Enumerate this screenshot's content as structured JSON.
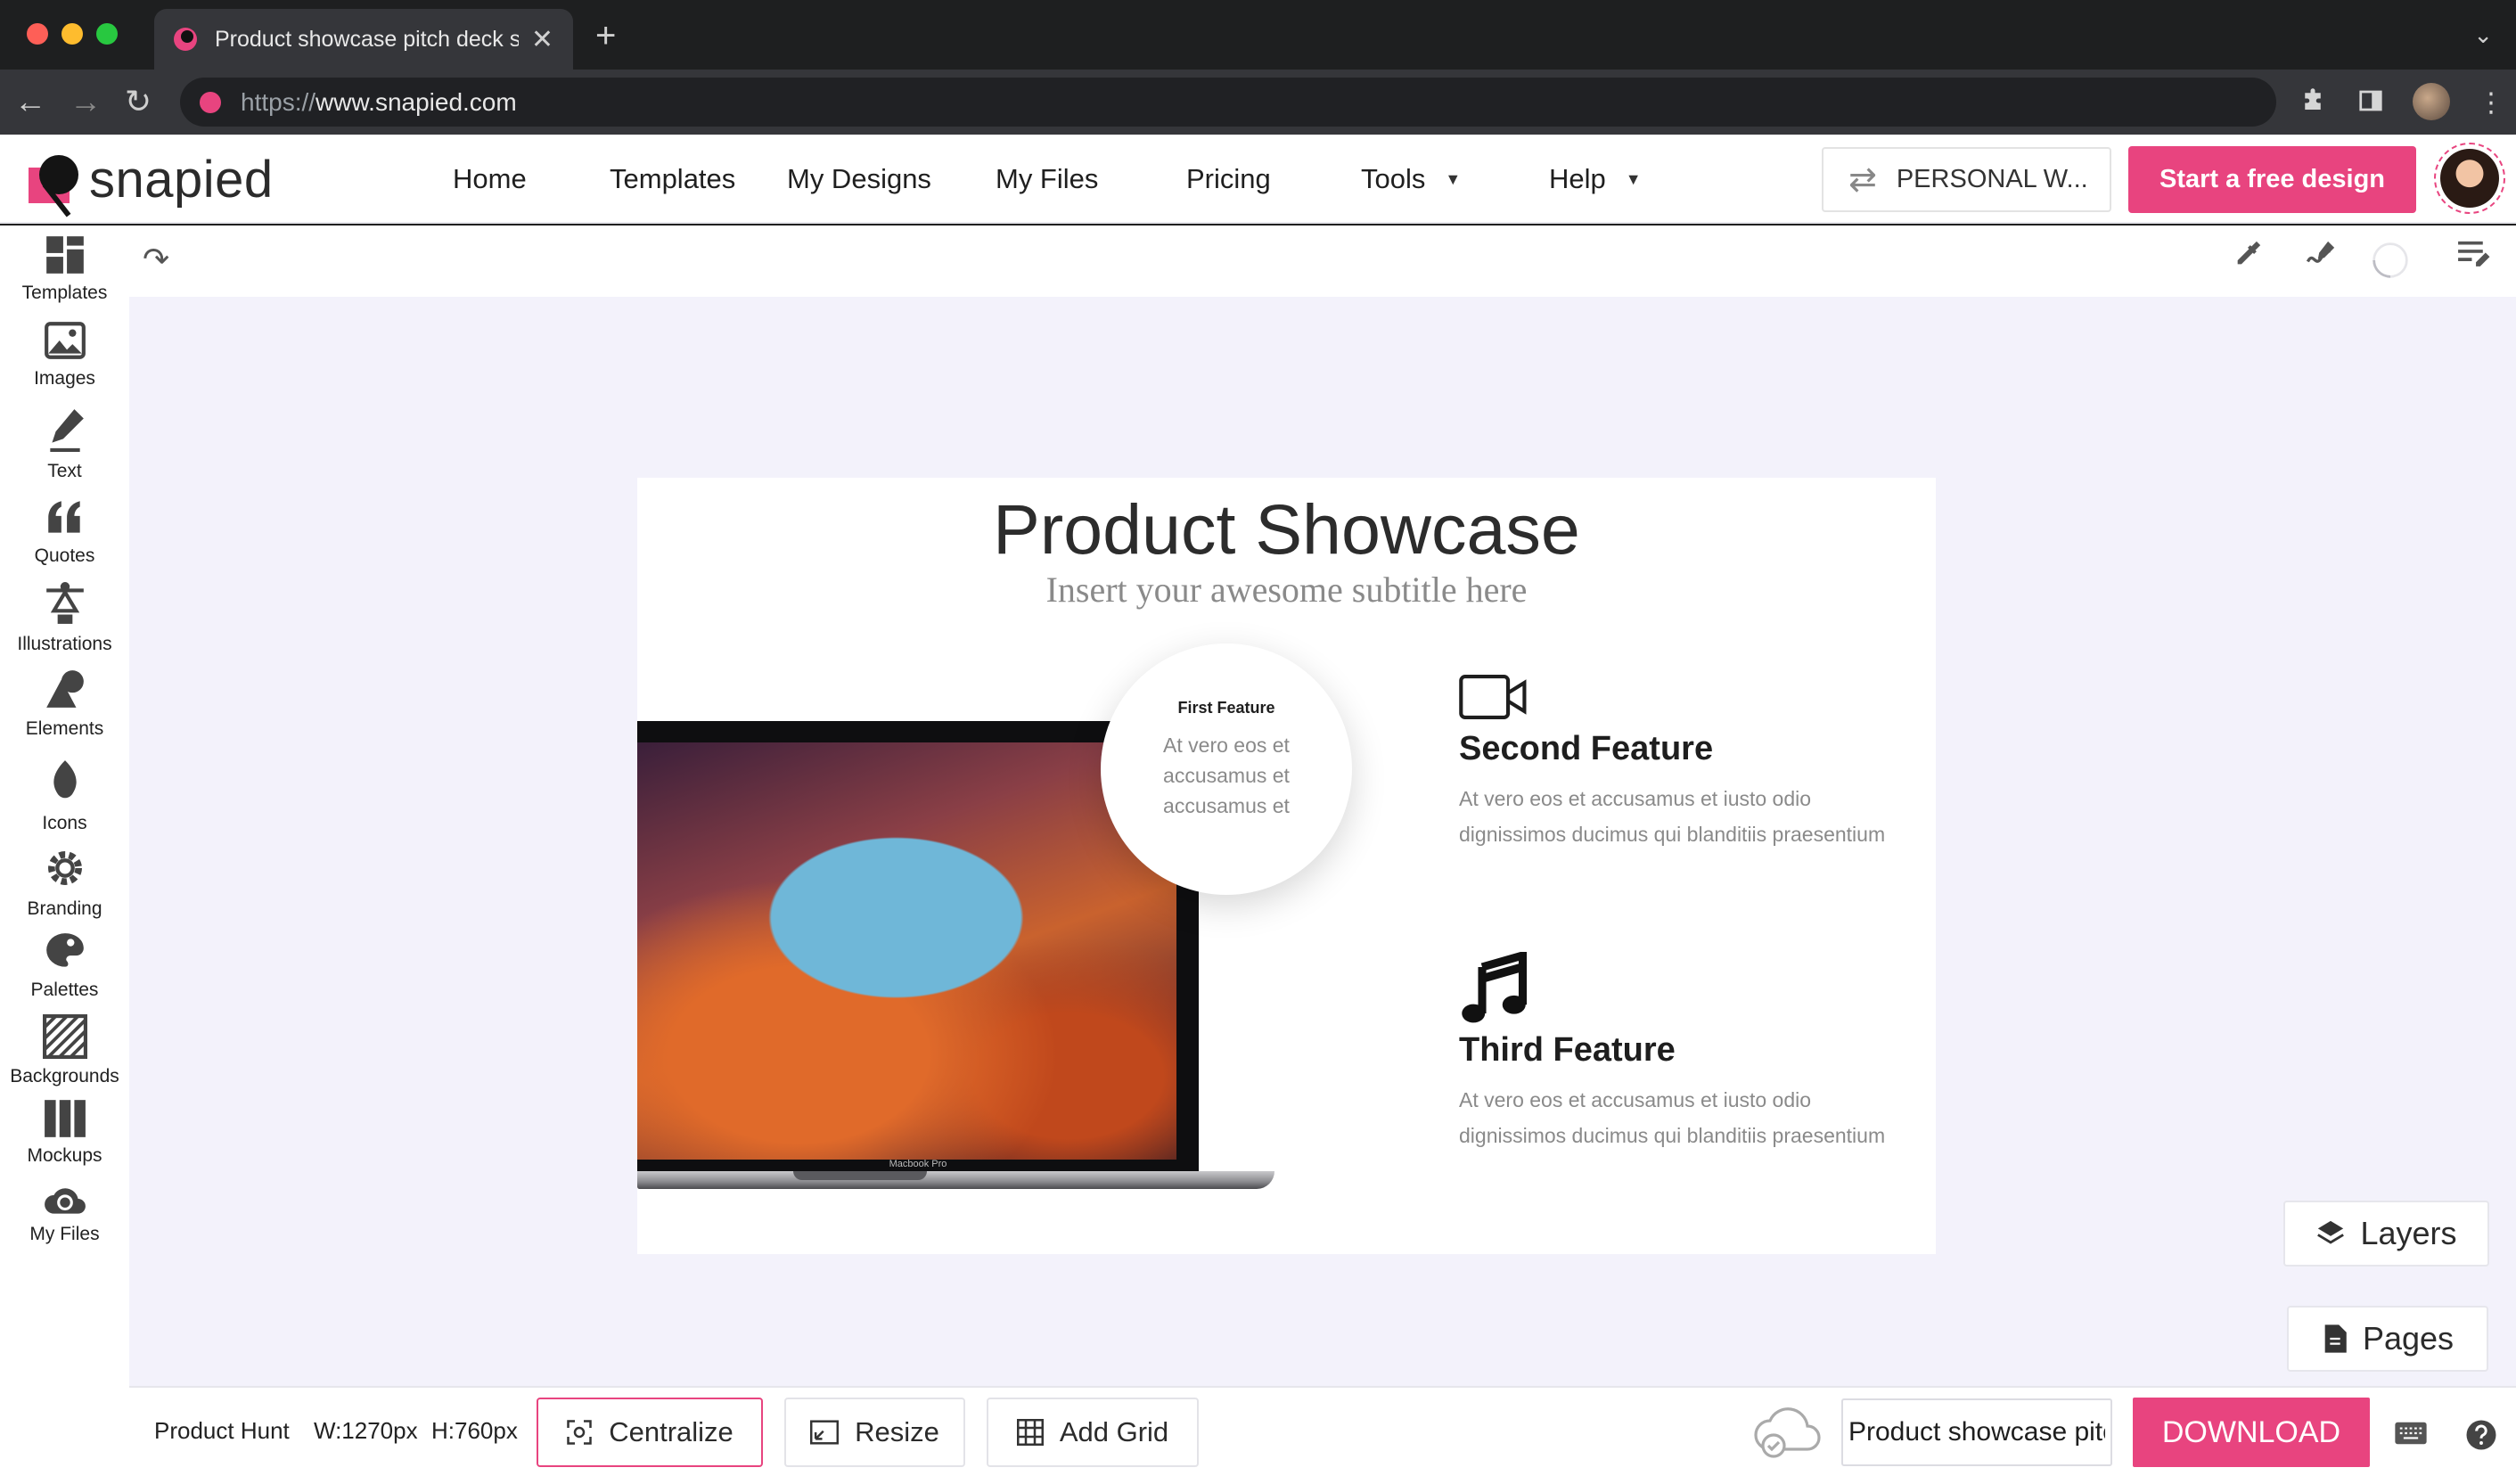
{
  "browser": {
    "tab_title": "Product showcase pitch deck s",
    "url_scheme": "https://",
    "url_host": "www.snapied.com"
  },
  "header": {
    "brand": "snapied",
    "nav": [
      {
        "label": "Home"
      },
      {
        "label": "Templates"
      },
      {
        "label": "My Designs"
      },
      {
        "label": "My Files"
      },
      {
        "label": "Pricing"
      },
      {
        "label": "Tools"
      },
      {
        "label": "Help"
      }
    ],
    "workspace_label": "PERSONAL W...",
    "start_label": "Start a free design"
  },
  "sidebar": {
    "items": [
      {
        "label": "Templates",
        "icon": "templates-icon"
      },
      {
        "label": "Images",
        "icon": "image-icon"
      },
      {
        "label": "Text",
        "icon": "pen-icon"
      },
      {
        "label": "Quotes",
        "icon": "quote-icon"
      },
      {
        "label": "Illustrations",
        "icon": "pen-tool-icon"
      },
      {
        "label": "Elements",
        "icon": "shapes-icon"
      },
      {
        "label": "Icons",
        "icon": "leaf-icon"
      },
      {
        "label": "Branding",
        "icon": "gear-icon"
      },
      {
        "label": "Palettes",
        "icon": "palette-icon"
      },
      {
        "label": "Backgrounds",
        "icon": "pattern-icon"
      },
      {
        "label": "Mockups",
        "icon": "columns-icon"
      },
      {
        "label": "My Files",
        "icon": "cloud-upload-icon"
      }
    ]
  },
  "slide": {
    "title": "Product Showcase",
    "subtitle": "Insert your awesome subtitle here",
    "laptop_label": "Macbook Pro",
    "first_feature": {
      "title": "First Feature",
      "text": "At vero eos et accusamus et accusamus et"
    },
    "second_feature": {
      "title": "Second Feature",
      "text": "At vero eos et accusamus et iusto odio dignissimos ducimus qui blanditiis praesentium",
      "icon": "video-camera-icon"
    },
    "third_feature": {
      "title": "Third Feature",
      "text": "At vero eos et accusamus et iusto odio dignissimos ducimus qui blanditiis praesentium",
      "icon": "music-note-icon"
    }
  },
  "panels": {
    "layers_label": "Layers",
    "pages_label": "Pages"
  },
  "bottombar": {
    "preset": "Product Hunt",
    "width": "W:1270px",
    "height": "H:760px",
    "centralize_label": "Centralize",
    "resize_label": "Resize",
    "add_grid_label": "Add Grid",
    "design_name": "Product showcase pitch deck",
    "download_label": "DOWNLOAD"
  },
  "colors": {
    "accent": "#e8447f",
    "canvas_bg": "#f3f2fb"
  }
}
